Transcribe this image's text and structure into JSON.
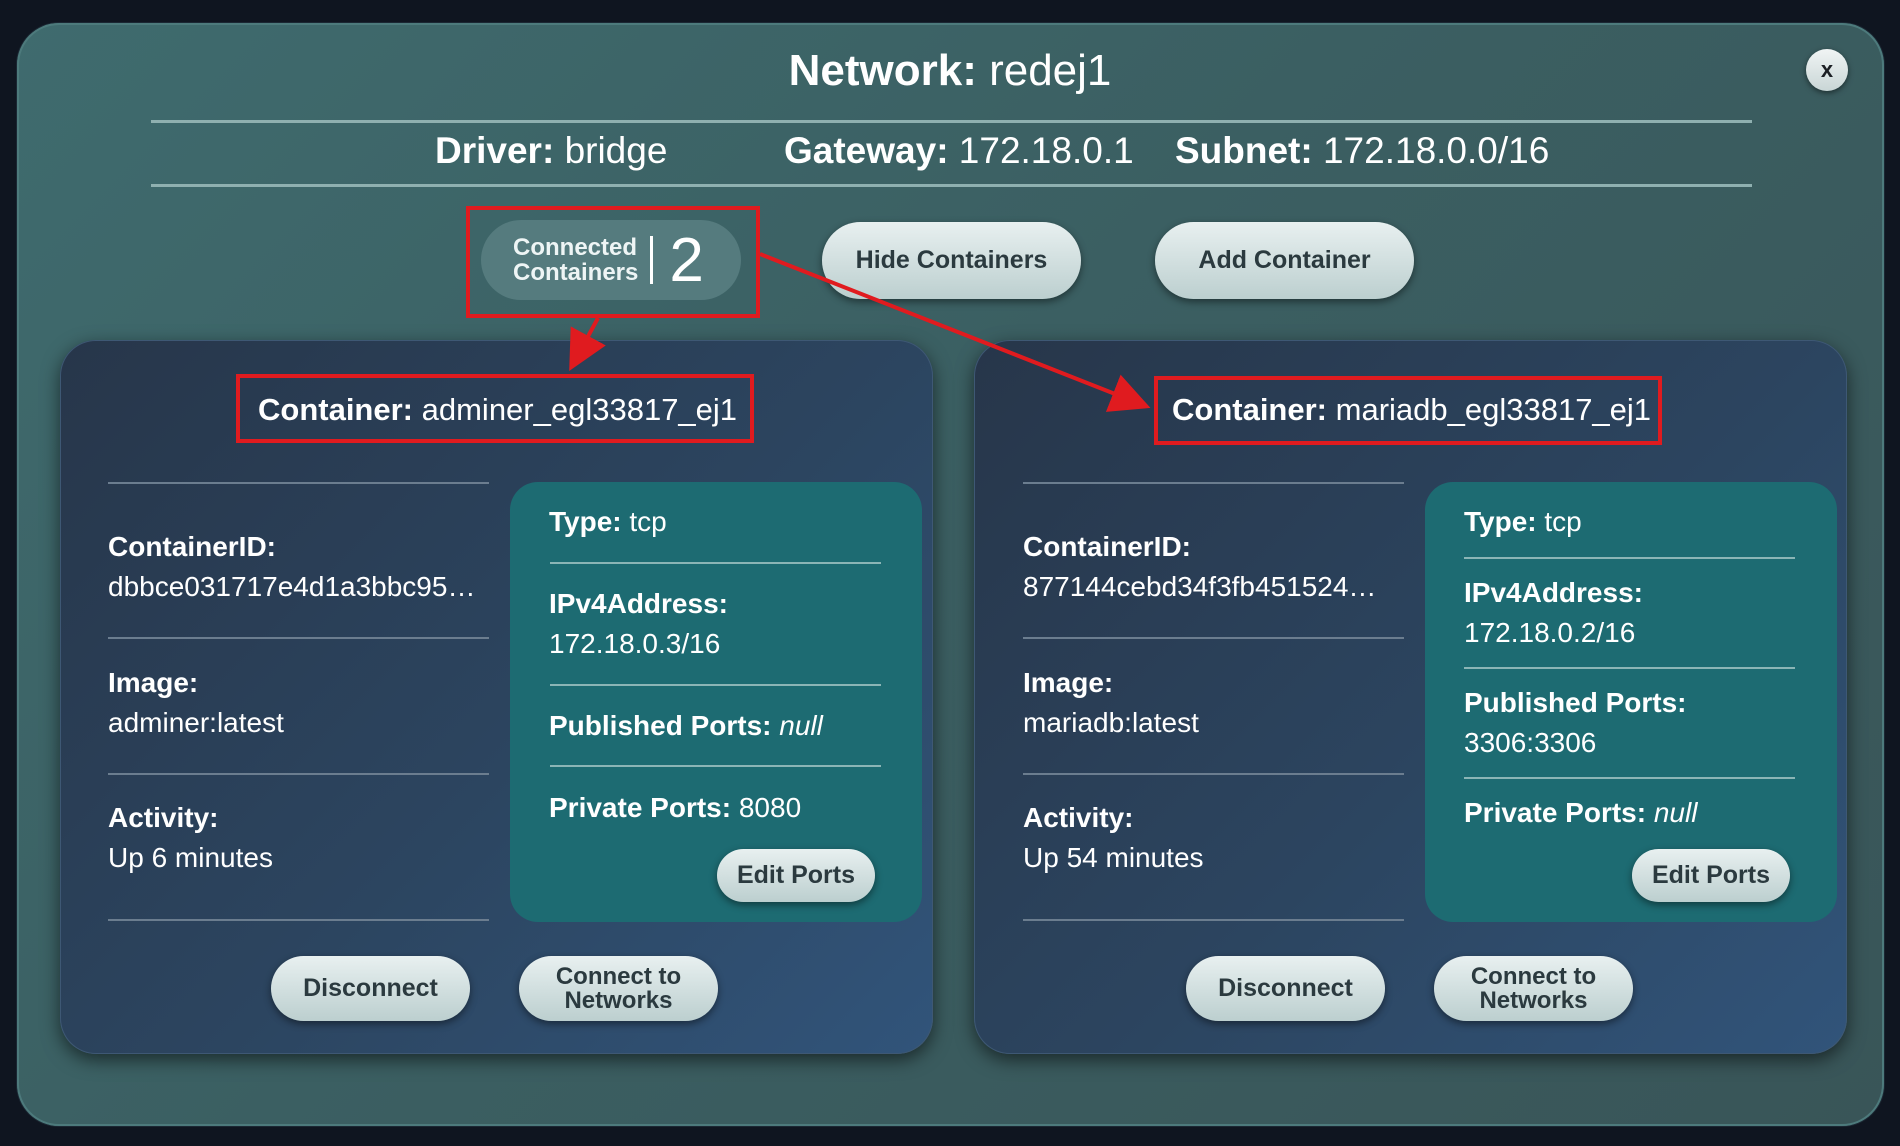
{
  "modal": {
    "close_label": "x",
    "title_label": "Network:",
    "title_value": "redej1",
    "driver_label": "Driver:",
    "driver_value": "bridge",
    "gateway_label": "Gateway:",
    "gateway_value": "172.18.0.1",
    "subnet_label": "Subnet:",
    "subnet_value": "172.18.0.0/16"
  },
  "controls": {
    "connected_line1": "Connected",
    "connected_line2": "Containers",
    "connected_count": "2",
    "hide_label": "Hide Containers",
    "add_label": "Add Container"
  },
  "containers": [
    {
      "title_label": "Container:",
      "name": "adminer_egl33817_ej1",
      "id_label": "ContainerID:",
      "id_value": "dbbce031717e4d1a3bbc95…",
      "image_label": "Image:",
      "image_value": "adminer:latest",
      "activity_label": "Activity:",
      "activity_value": "Up 6 minutes",
      "type_label": "Type:",
      "type_value": "tcp",
      "ipv4_label": "IPv4Address:",
      "ipv4_value": "172.18.0.3/16",
      "published_label": "Published Ports:",
      "published_value": "null",
      "private_label": "Private Ports:",
      "private_value": "8080",
      "edit_label": "Edit Ports",
      "disconnect_label": "Disconnect",
      "connect_line1": "Connect to",
      "connect_line2": "Networks"
    },
    {
      "title_label": "Container:",
      "name": "mariadb_egl33817_ej1",
      "id_label": "ContainerID:",
      "id_value": "877144cebd34f3fb451524…",
      "image_label": "Image:",
      "image_value": "mariadb:latest",
      "activity_label": "Activity:",
      "activity_value": "Up 54 minutes",
      "type_label": "Type:",
      "type_value": "tcp",
      "ipv4_label": "IPv4Address:",
      "ipv4_value": "172.18.0.2/16",
      "published_label": "Published Ports:",
      "published_value": "3306:3306",
      "private_label": "Private Ports:",
      "private_value": "null",
      "edit_label": "Edit Ports",
      "disconnect_label": "Disconnect",
      "connect_line1": "Connect to",
      "connect_line2": "Networks"
    }
  ],
  "colors": {
    "annotation_red": "#e01b1f",
    "modal_bg": "#3f6b6e",
    "card_bg": "#2c4560",
    "ports_bg": "#1d6b72"
  }
}
